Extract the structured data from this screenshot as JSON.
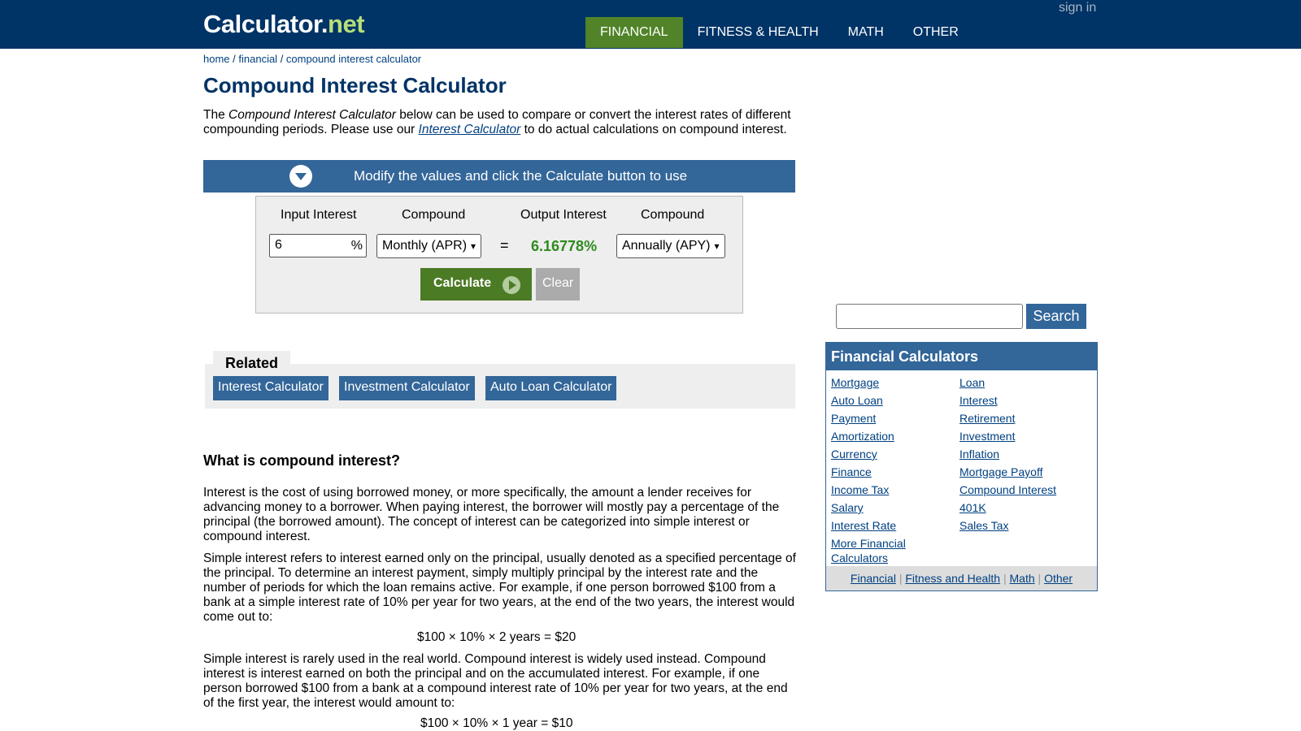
{
  "header": {
    "logo_main": "Calculator",
    "logo_dot": ".",
    "logo_net": "net",
    "nav": [
      "FINANCIAL",
      "FITNESS & HEALTH",
      "MATH",
      "OTHER"
    ],
    "signin": "sign in"
  },
  "breadcrumb": {
    "home": "home",
    "sep1": " / ",
    "financial": "financial",
    "sep2": " / ",
    "current": "compound interest calculator"
  },
  "title": "Compound Interest Calculator",
  "intro": {
    "p1": "The ",
    "italic": "Compound Interest Calculator",
    "p2": " below can be used to compare or convert the interest rates of different compounding periods. Please use our ",
    "link": "Interest Calculator",
    "p3": " to do actual calculations on compound interest."
  },
  "banner": {
    "text": "Modify the values and click the Calculate button to use"
  },
  "calculator": {
    "input_interest_label": "Input Interest",
    "compound_label_1": "Compound",
    "output_interest_label": "Output Interest",
    "compound_label_2": "Compound",
    "input_value": "6",
    "percent_sign": "%",
    "input_compound": "Monthly (APR)",
    "equals": "=",
    "output_value": "6.16778%",
    "output_compound": "Annually (APY)",
    "calculate": "Calculate",
    "clear": "Clear"
  },
  "related": {
    "title": "Related",
    "links": [
      "Interest Calculator",
      "Investment Calculator",
      "Auto Loan Calculator"
    ]
  },
  "article": {
    "heading": "What is compound interest?",
    "p1": "Interest is the cost of using borrowed money, or more specifically, the amount a lender receives for advancing money to a borrower. When paying interest, the borrower will mostly pay a percentage of the principal (the borrowed amount). The concept of interest can be categorized into simple interest or compound interest.",
    "p2": "Simple interest refers to interest earned only on the principal, usually denoted as a specified percentage of the principal. To determine an interest payment, simply multiply principal by the interest rate and the number of periods for which the loan remains active. For example, if one person borrowed $100 from a bank at a simple interest rate of 10% per year for two years, at the end of the two years, the interest would come out to:",
    "formula1": "$100 × 10% × 2 years = $20",
    "p3": "Simple interest is rarely used in the real world. Compound interest is widely used instead. Compound interest is interest earned on both the principal and on the accumulated interest. For example, if one person borrowed $100 from a bank at a compound interest rate of 10% per year for two years, at the end of the first year, the interest would amount to:",
    "formula2": "$100 × 10% × 1 year = $10"
  },
  "sidebar": {
    "search_button": "Search",
    "financial_title": "Financial Calculators",
    "col1": [
      "Mortgage",
      "Auto Loan",
      "Payment",
      "Amortization",
      "Currency",
      "Finance",
      "Income Tax",
      "Salary",
      "Interest Rate",
      "More Financial Calculators"
    ],
    "col2": [
      "Loan",
      "Interest",
      "Retirement",
      "Investment",
      "Inflation",
      "Mortgage Payoff",
      "Compound Interest",
      "401K",
      "Sales Tax"
    ],
    "footer_links": [
      "Financial",
      "Fitness and Health",
      "Math",
      "Other"
    ],
    "footer_sep": "|"
  },
  "colors": {
    "header": "#003366",
    "accent_green": "#518428",
    "button_blue": "#336699",
    "output_green": "#2e8b1f"
  },
  "icons": [
    "chevron-down-circle-icon",
    "play-circle-icon"
  ]
}
